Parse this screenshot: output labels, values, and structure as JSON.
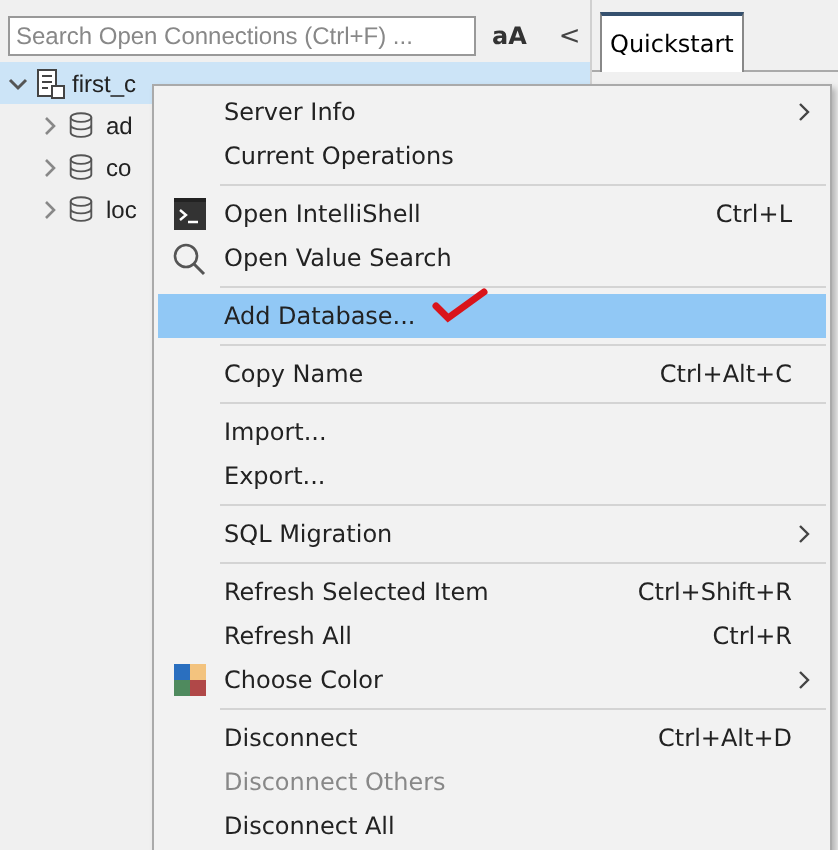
{
  "search": {
    "placeholder": "Search Open Connections (Ctrl+F) ..."
  },
  "toolbar": {
    "font_toggle": "aA",
    "collapse": "<"
  },
  "tabs": [
    {
      "label": "Quickstart",
      "selected": true
    }
  ],
  "tree": [
    {
      "label": "first_c",
      "expanded": true,
      "selected": true,
      "children": [
        {
          "label": "ad",
          "expanded": false,
          "selected": false
        },
        {
          "label": "co",
          "expanded": false,
          "selected": false
        },
        {
          "label": "loc",
          "expanded": false,
          "selected": false
        }
      ]
    }
  ],
  "context_menu": {
    "groups": [
      [
        {
          "label": "Server Info",
          "submenu": true,
          "disabled": false,
          "selected": false
        },
        {
          "label": "Current Operations",
          "disabled": false,
          "selected": false
        }
      ],
      [
        {
          "label": "Open IntelliShell",
          "kind": "terminal",
          "shortcut": "Ctrl+L",
          "disabled": false,
          "selected": false
        },
        {
          "label": "Open Value Search",
          "kind": "search",
          "disabled": false,
          "selected": false
        }
      ],
      [
        {
          "label": "Add Database...",
          "disabled": false,
          "selected": true,
          "annotated": true
        }
      ],
      [
        {
          "label": "Copy Name",
          "shortcut": "Ctrl+Alt+C",
          "disabled": false,
          "selected": false
        }
      ],
      [
        {
          "label": "Import...",
          "disabled": false,
          "selected": false
        },
        {
          "label": "Export...",
          "disabled": false,
          "selected": false
        }
      ],
      [
        {
          "label": "SQL Migration",
          "submenu": true,
          "disabled": false,
          "selected": false
        }
      ],
      [
        {
          "label": "Refresh Selected Item",
          "shortcut": "Ctrl+Shift+R",
          "disabled": false,
          "selected": false
        },
        {
          "label": "Refresh All",
          "shortcut": "Ctrl+R",
          "disabled": false,
          "selected": false
        },
        {
          "label": "Choose Color",
          "kind": "palette",
          "submenu": true,
          "disabled": false,
          "selected": false
        }
      ],
      [
        {
          "label": "Disconnect",
          "shortcut": "Ctrl+Alt+D",
          "disabled": false,
          "selected": false
        },
        {
          "label": "Disconnect Others",
          "disabled": true,
          "selected": false
        },
        {
          "label": "Disconnect All",
          "disabled": false,
          "selected": false
        }
      ]
    ]
  }
}
